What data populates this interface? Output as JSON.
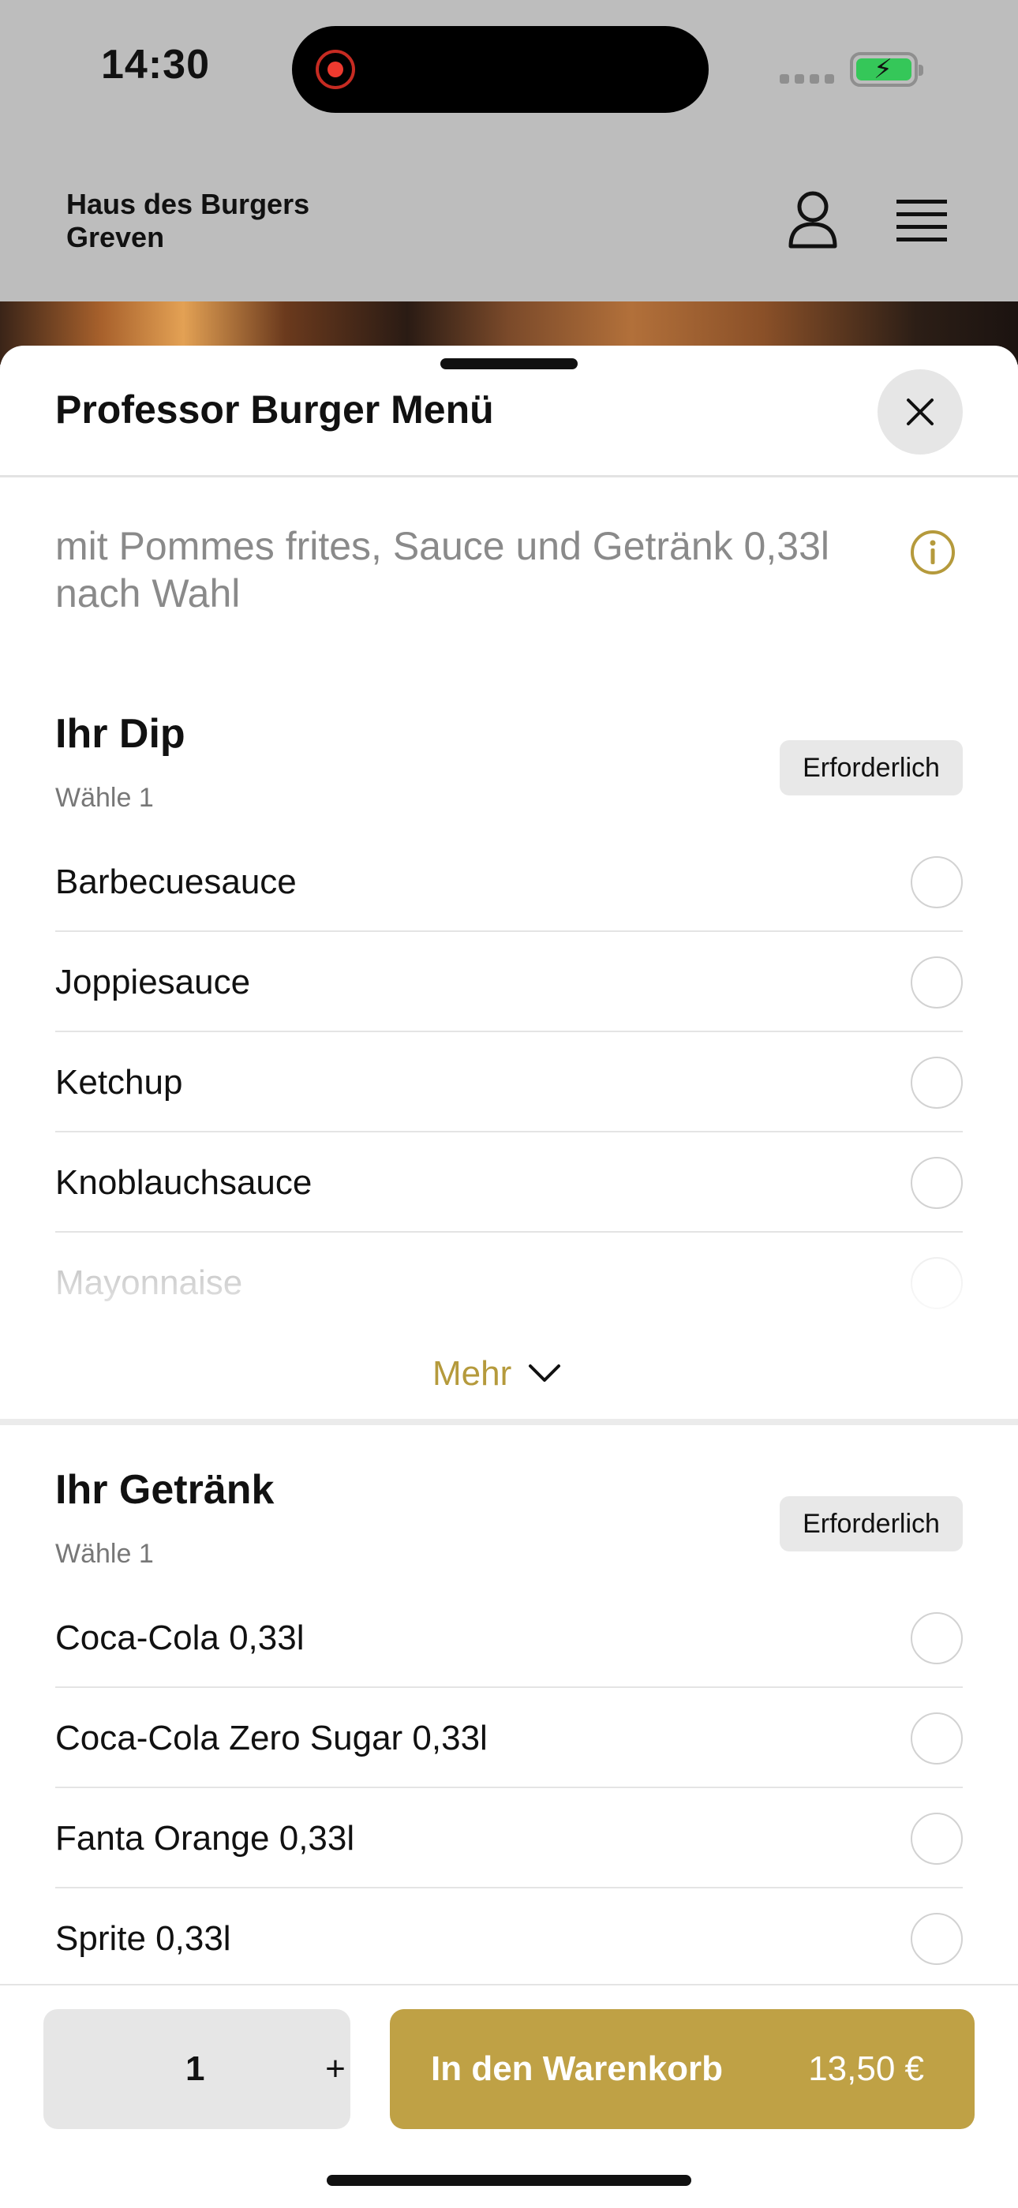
{
  "status_bar": {
    "time": "14:30"
  },
  "header": {
    "restaurant_line1": "Haus des Burgers",
    "restaurant_line2": "Greven",
    "icons": [
      "account-icon",
      "menu-icon"
    ]
  },
  "sheet": {
    "title": "Professor Burger Menü",
    "description": "mit Pommes frites, Sauce und Getränk 0,33l nach Wahl"
  },
  "sections": [
    {
      "title": "Ihr Dip",
      "subtitle": "Wähle 1",
      "badge": "Erforderlich",
      "options": [
        "Barbecuesauce",
        "Joppiesauce",
        "Ketchup",
        "Knoblauchsauce",
        "Mayonnaise"
      ],
      "more_label": "Mehr"
    },
    {
      "title": "Ihr Getränk",
      "subtitle": "Wähle 1",
      "badge": "Erforderlich",
      "options": [
        "Coca-Cola 0,33l",
        "Coca-Cola Zero Sugar 0,33l",
        "Fanta Orange 0,33l",
        "Sprite 0,33l"
      ]
    }
  ],
  "cart_bar": {
    "quantity": "1",
    "plus": "+",
    "add_label": "In den Warenkorb",
    "price": "13,50 €"
  },
  "colors": {
    "accent": "#bfa145",
    "accent_text": "#b59a3c",
    "battery": "#35c759",
    "record": "#ee3a2f"
  }
}
